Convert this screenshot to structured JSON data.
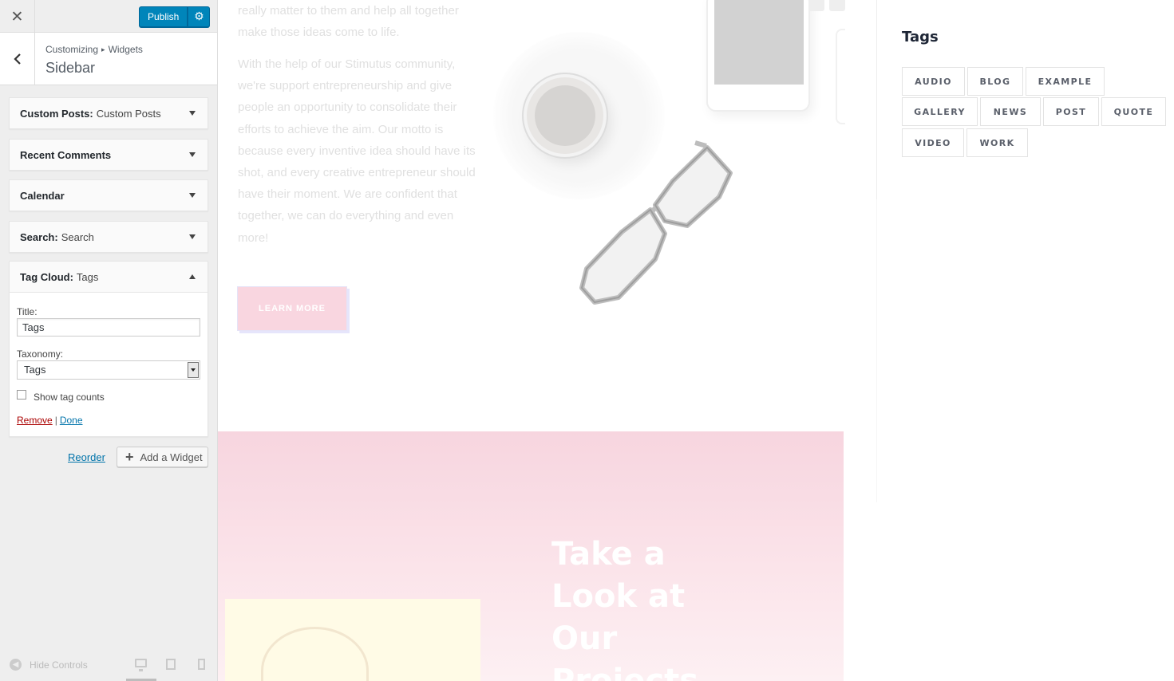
{
  "customizer": {
    "close_icon": "close-icon",
    "publish_label": "Publish",
    "gear_icon": "gear-icon",
    "back_icon": "chevron-left-icon",
    "breadcrumb": {
      "root": "Customizing",
      "separator": "▸",
      "parent": "Widgets"
    },
    "section_title": "Sidebar",
    "widgets": [
      {
        "type": "Custom Posts:",
        "title": "Custom Posts",
        "expanded": false
      },
      {
        "type": "Recent Comments",
        "title": "",
        "expanded": false
      },
      {
        "type": "Calendar",
        "title": "",
        "expanded": false
      },
      {
        "type": "Search:",
        "title": "Search",
        "expanded": false
      },
      {
        "type": "Tag Cloud:",
        "title": "Tags",
        "expanded": true
      }
    ],
    "tag_cloud_form": {
      "title_label": "Title:",
      "title_value": "Tags",
      "taxonomy_label": "Taxonomy:",
      "taxonomy_value": "Tags",
      "show_counts_label": "Show tag counts",
      "show_counts_checked": false,
      "remove_label": "Remove",
      "separator": "|",
      "done_label": "Done"
    },
    "reorder_label": "Reorder",
    "add_widget_label": "Add a Widget",
    "hide_controls_label": "Hide Controls",
    "devices": [
      "desktop-icon",
      "tablet-icon",
      "mobile-icon"
    ]
  },
  "preview": {
    "paragraph_1": "really matter to them and help all together make those ideas come to life.",
    "paragraph_2": "With the help of our Stimutus community, we're support entrepreneurship and give people an opportunity to consolidate their efforts to achieve the aim. Our motto is because every inventive idea should have its shot, and every creative entrepreneur should have their moment. We are confident that together, we can do everything and even more!",
    "learn_more_label": "LEARN MORE",
    "heading_line_1": "Take a",
    "heading_line_2": "Look at",
    "heading_line_3": "Our",
    "heading_line_4": "Projects",
    "tags_title": "Tags",
    "tags": [
      "AUDIO",
      "BLOG",
      "EXAMPLE",
      "GALLERY",
      "NEWS",
      "POST",
      "QUOTE",
      "VIDEO",
      "WORK"
    ]
  },
  "colors": {
    "publish_blue": "#0085ba",
    "link_blue": "#0073aa",
    "remove_red": "#aa0000",
    "pink_band": "#f7d5df",
    "learn_more_bg": "#f9d6e0"
  }
}
